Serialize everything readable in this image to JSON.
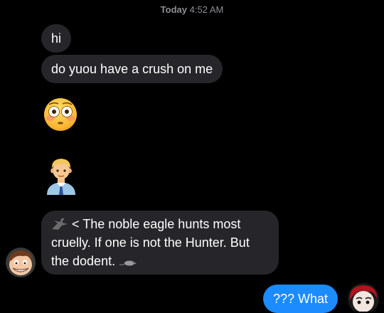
{
  "thread": {
    "timestamp_day": "Today",
    "timestamp_time": "4:52 AM"
  },
  "messages": {
    "m1": "hi",
    "m2": "do yuou have a crush on me",
    "m3_emoji": "flushed-face",
    "m4_emoji": "man-office-worker",
    "m5_part1": "< The noble eagle hunts most cruelly. If one is not the Hunter. But the dodent.",
    "m6_sent": "??? What"
  },
  "colors": {
    "incoming_bubble": "#26262a",
    "outgoing_bubble": "#1c8bfd",
    "background": "#000000",
    "timestamp": "#8e8e93"
  },
  "icons": {
    "eagle": "eagle-icon",
    "rodent": "rodent-icon"
  }
}
